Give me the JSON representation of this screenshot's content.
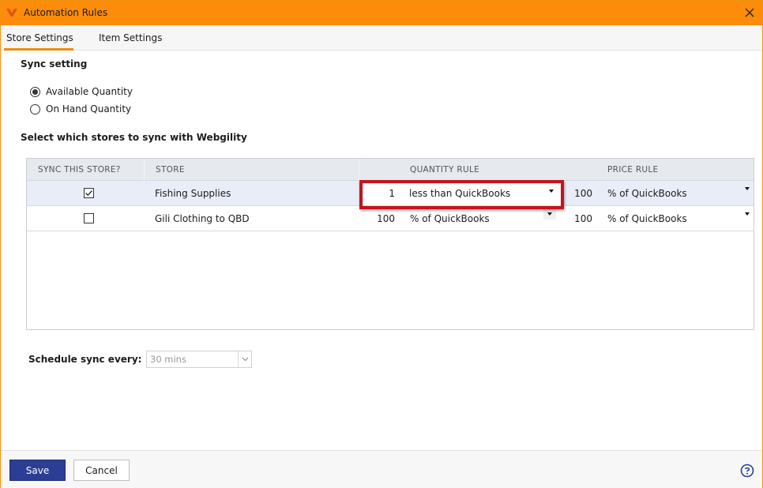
{
  "window": {
    "title": "Automation Rules"
  },
  "tabs": [
    {
      "label": "Store Settings",
      "active": true
    },
    {
      "label": "Item Settings",
      "active": false
    }
  ],
  "sync_setting": {
    "title": "Sync setting",
    "options": [
      {
        "label": "Available Quantity",
        "selected": true
      },
      {
        "label": "On Hand Quantity",
        "selected": false
      }
    ]
  },
  "stores_section": {
    "title": "Select which stores to sync with Webgility"
  },
  "grid": {
    "headers": {
      "sync": "SYNC THIS STORE?",
      "store": "STORE",
      "quantity_rule": "QUANTITY RULE",
      "price_rule": "PRICE RULE"
    },
    "rows": [
      {
        "checked": true,
        "store": "Fishing Supplies",
        "qty_value": "1",
        "qty_rule": "less than QuickBooks",
        "price_value": "100",
        "price_rule": "% of QuickBooks"
      },
      {
        "checked": false,
        "store": "Gili Clothing to QBD",
        "qty_value": "100",
        "qty_rule": "% of QuickBooks",
        "price_value": "100",
        "price_rule": "% of QuickBooks"
      }
    ]
  },
  "schedule": {
    "label": "Schedule sync every:",
    "value": "30 mins"
  },
  "footer": {
    "save_label": "Save",
    "cancel_label": "Cancel"
  },
  "colors": {
    "titlebar": "#fd8c0a",
    "accent_tab": "#f08a12",
    "save_button": "#2b3e94",
    "highlight": "#c4141b",
    "help_icon": "#2b3e94"
  },
  "icons": {
    "app": "webgility-logo-icon",
    "close": "close-icon",
    "check": "checkmark-icon",
    "dropdown": "caret-down-icon",
    "help": "help-icon"
  }
}
